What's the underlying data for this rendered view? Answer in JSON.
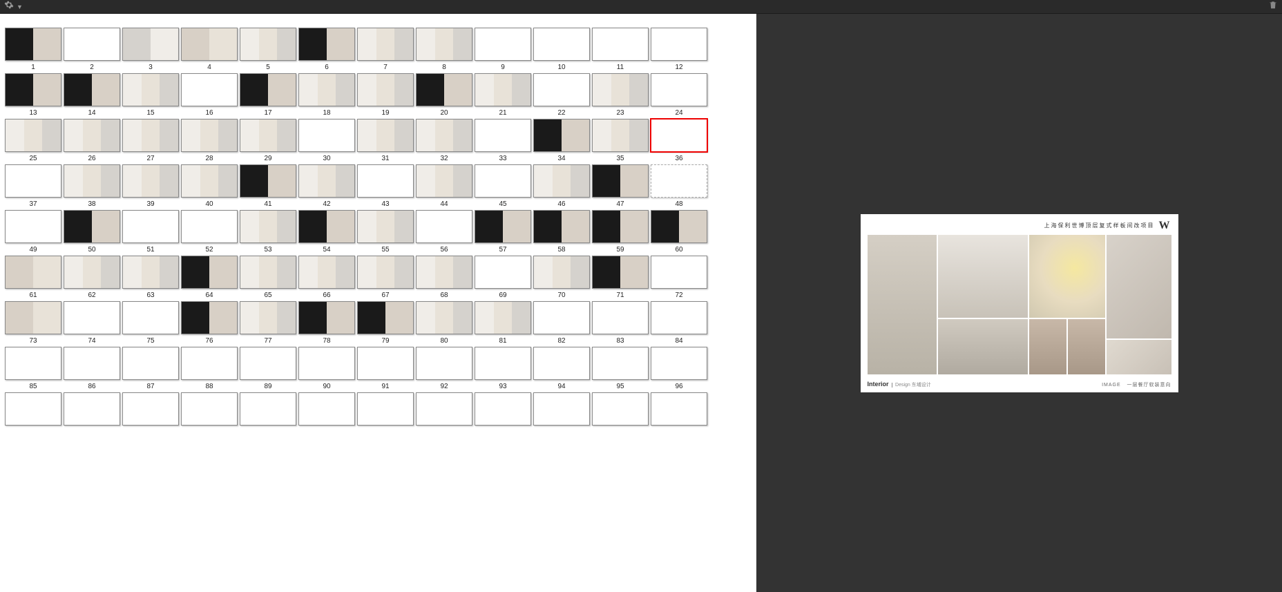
{
  "toolbar": {
    "menu_icon": "gear-icon",
    "trash_icon": "trash-icon"
  },
  "preview": {
    "header_title": "上海保利世博顶层复式样板间改项目",
    "logo": "W",
    "footer_brand_main": "Interior",
    "footer_brand_sub": "Design 东埔设计",
    "footer_right_label": "IMAGE",
    "footer_right_text": "一层餐厅软装意向"
  },
  "grid": {
    "selected_index": 24,
    "empty_index": 36,
    "rows": [
      {
        "start": null,
        "count": 12
      },
      {
        "start": 1,
        "count": 12
      },
      {
        "start": 13,
        "count": 12
      },
      {
        "start": 25,
        "count": 12
      },
      {
        "start": 37,
        "count": 12
      },
      {
        "start": 49,
        "count": 12
      },
      {
        "start": 61,
        "count": 12
      },
      {
        "start": 73,
        "count": 12
      },
      {
        "start": 85,
        "count": 12
      }
    ],
    "thumb_styles": [
      [
        "dark",
        "white",
        "gray",
        "warm",
        "light",
        "dark",
        "light",
        "light",
        "white",
        "white",
        "white",
        "white"
      ],
      [
        "dark",
        "dark",
        "light",
        "white",
        "dark",
        "light",
        "light",
        "dark",
        "light",
        "white",
        "light",
        "white"
      ],
      [
        "light",
        "light",
        "light",
        "light",
        "light",
        "white",
        "light",
        "light",
        "white",
        "dark",
        "light",
        "white"
      ],
      [
        "white",
        "light",
        "light",
        "light",
        "dark",
        "light",
        "white",
        "light",
        "white",
        "light",
        "dark",
        "empty"
      ],
      [
        "white",
        "dark",
        "white",
        "white",
        "light",
        "dark",
        "light",
        "white",
        "dark",
        "dark",
        "dark",
        "dark"
      ],
      [
        "warm",
        "light",
        "light",
        "dark",
        "light",
        "light",
        "light",
        "light",
        "white",
        "light",
        "dark",
        "white"
      ],
      [
        "warm",
        "white",
        "white",
        "dark",
        "light",
        "dark",
        "dark",
        "light",
        "light",
        "white",
        "white",
        "white"
      ],
      [
        "white",
        "white",
        "white",
        "white",
        "white",
        "white",
        "white",
        "white",
        "white",
        "white",
        "white",
        "white"
      ],
      [
        "white",
        "white",
        "white",
        "white",
        "white",
        "white",
        "white",
        "white",
        "white",
        "white",
        "white",
        "white"
      ]
    ]
  }
}
